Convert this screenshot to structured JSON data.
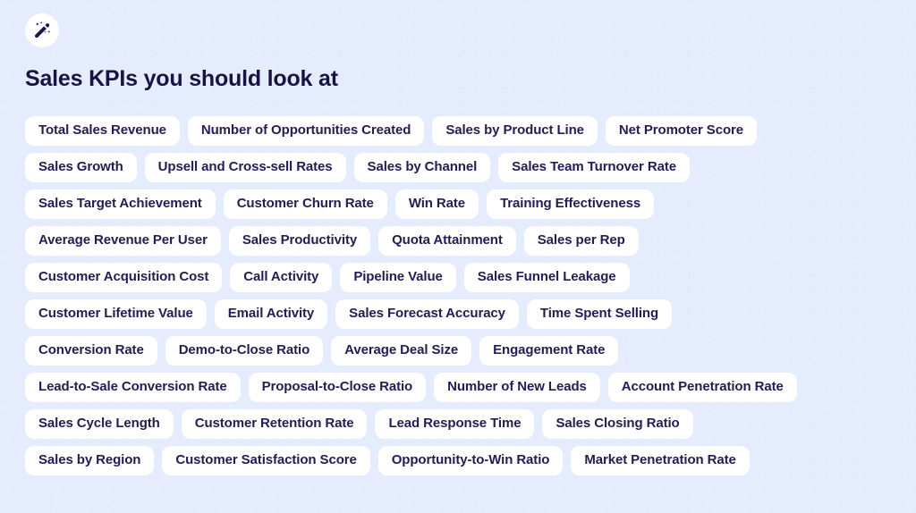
{
  "header": {
    "icon": "magic-wand-icon",
    "title": "Sales KPIs you should look at"
  },
  "theme": {
    "background": "#e4ecfd",
    "pill_background": "#ffffff",
    "text_color": "#241c52",
    "title_color": "#181442"
  },
  "kpi_rows": [
    {
      "pills": [
        "Total Sales Revenue",
        "Number of Opportunities Created",
        "Sales by Product Line",
        "Net Promoter Score"
      ]
    },
    {
      "pills": [
        "Sales Growth",
        "Upsell and Cross-sell Rates",
        "Sales by Channel",
        "Sales Team Turnover Rate"
      ]
    },
    {
      "pills": [
        "Sales Target Achievement",
        "Customer Churn Rate",
        "Win Rate",
        "Training Effectiveness"
      ]
    },
    {
      "pills": [
        "Average Revenue Per User",
        "Sales Productivity",
        "Quota Attainment",
        "Sales per Rep"
      ]
    },
    {
      "pills": [
        "Customer Acquisition Cost",
        "Call Activity",
        "Pipeline Value",
        "Sales Funnel Leakage"
      ]
    },
    {
      "pills": [
        "Customer Lifetime Value",
        "Email Activity",
        "Sales Forecast Accuracy",
        "Time Spent Selling"
      ]
    },
    {
      "pills": [
        "Conversion Rate",
        "Demo-to-Close Ratio",
        "Average Deal Size",
        "Engagement Rate"
      ]
    },
    {
      "pills": [
        "Lead-to-Sale Conversion Rate",
        "Proposal-to-Close Ratio",
        "Number of New Leads",
        "Account Penetration Rate"
      ]
    },
    {
      "pills": [
        "Sales Cycle Length",
        "Customer Retention Rate",
        "Lead Response Time",
        "Sales Closing Ratio"
      ]
    },
    {
      "pills": [
        "Sales by Region",
        "Customer Satisfaction Score",
        "Opportunity-to-Win Ratio",
        "Market Penetration Rate"
      ]
    }
  ]
}
